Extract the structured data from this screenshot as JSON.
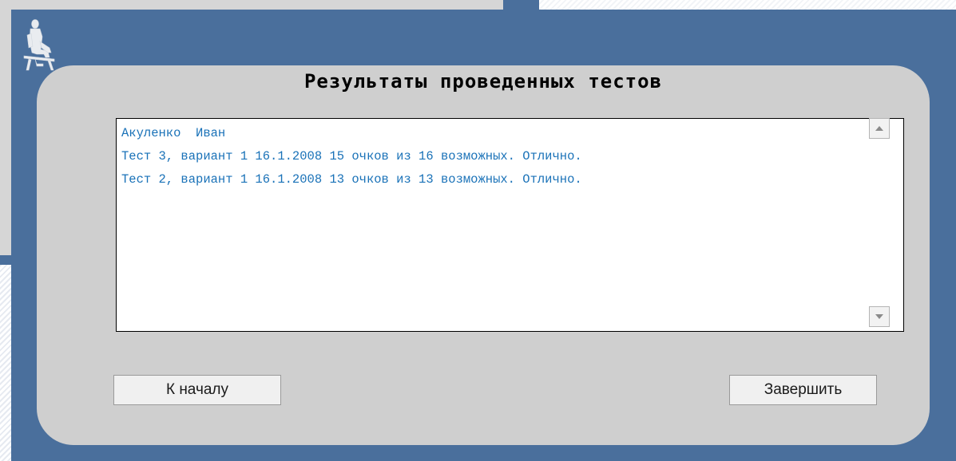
{
  "dialog": {
    "title": "Результаты проведенных тестов"
  },
  "results": {
    "lines": [
      "Акуленко  Иван",
      "Тест 3, вариант 1 16.1.2008 15 очков из 16 возможных. Отлично.",
      "Тест 2, вариант 1 16.1.2008 13 очков из 13 возможных. Отлично."
    ]
  },
  "buttons": {
    "start_label": "К началу",
    "finish_label": "Завершить"
  },
  "icons": {
    "figure": "seated-figure-icon",
    "scroll_up": "arrow-up-icon",
    "scroll_down": "arrow-down-icon"
  },
  "colors": {
    "background_blue": "#4a6f9c",
    "panel_grey": "#cfcfcf",
    "results_text": "#1a72b8"
  }
}
